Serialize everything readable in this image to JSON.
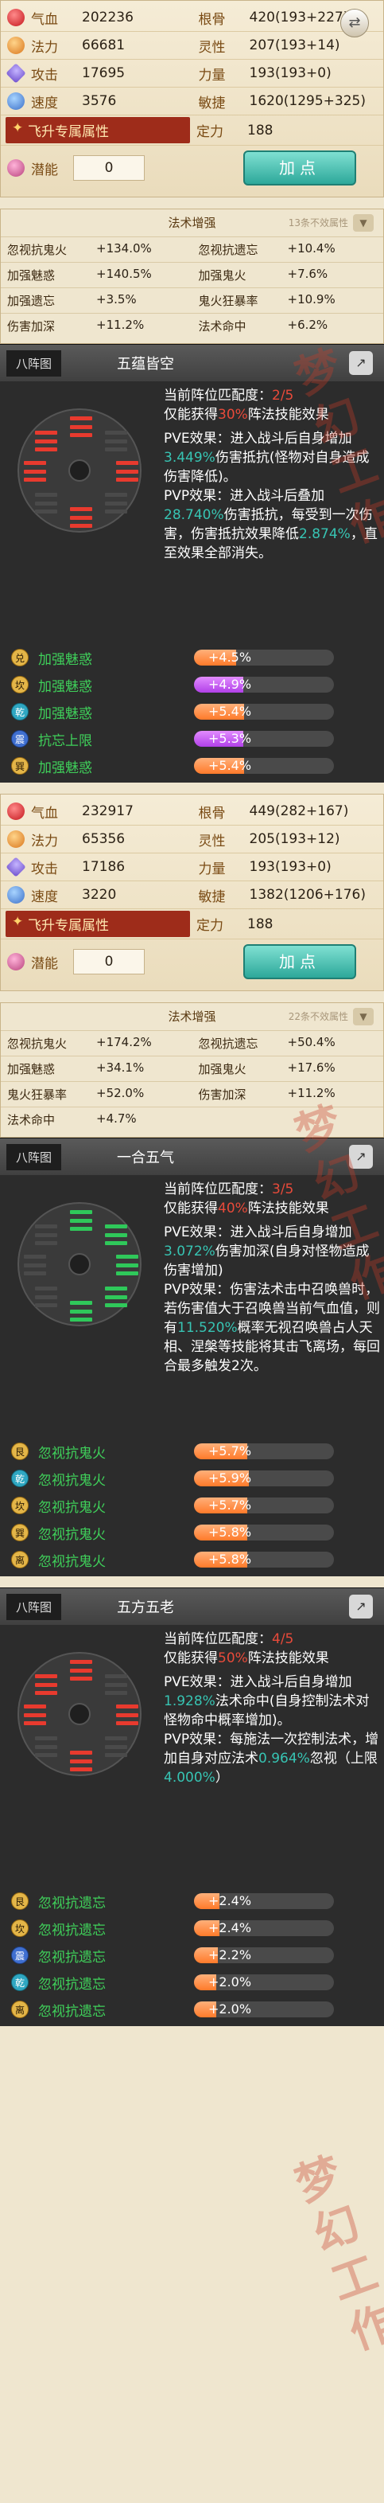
{
  "blocks": [
    {
      "stats": {
        "hp": {
          "label": "气血",
          "value": "202236"
        },
        "bone": {
          "label": "根骨",
          "value": "420(193+227)"
        },
        "mp": {
          "label": "法力",
          "value": "66681"
        },
        "spirit": {
          "label": "灵性",
          "value": "207(193+14)"
        },
        "atk": {
          "label": "攻击",
          "value": "17695"
        },
        "str": {
          "label": "力量",
          "value": "193(193+0)"
        },
        "spd": {
          "label": "速度",
          "value": "3576"
        },
        "agi": {
          "label": "敏捷",
          "value": "1620(1295+325)"
        },
        "ascend_label": "飞升专属属性",
        "focus": {
          "label": "定力",
          "value": "188"
        },
        "potential": {
          "label": "潜能",
          "value": "0"
        },
        "add_button": "加点"
      },
      "boost": {
        "title": "法术增强",
        "effective": "13条不效属性",
        "rows": [
          [
            {
              "k": "忽视抗鬼火",
              "v": "+134.0%"
            },
            {
              "k": "忽视抗遗忘",
              "v": "+10.4%"
            }
          ],
          [
            {
              "k": "加强魅惑",
              "v": "+140.5%"
            },
            {
              "k": "加强鬼火",
              "v": "+7.6%"
            }
          ],
          [
            {
              "k": "加强遗忘",
              "v": "+3.5%"
            },
            {
              "k": "鬼火狂暴率",
              "v": "+10.9%"
            }
          ],
          [
            {
              "k": "伤害加深",
              "v": "+11.2%"
            },
            {
              "k": "法术命中",
              "v": "+6.2%"
            }
          ]
        ]
      },
      "formations": [
        {
          "tag": "八阵图",
          "name": "五蕴皆空",
          "match_prefix": "当前阵位匹配度：",
          "match": "2/5",
          "gain_prefix": "仅能获得",
          "gain": "30%",
          "gain_suffix": "阵法技能效果",
          "pve": "PVE效果：进入战斗后自身增加",
          "pve_val": "3.449%",
          "pve_tail": "伤害抵抗(怪物对自身造成伤害降低)。",
          "pvp": "PVP效果：进入战斗后叠加",
          "pvp_val": "28.740%",
          "pvp_mid": "伤害抵抗，每受到一次伤害，伤害抵抗效果降低",
          "pvp_val2": "2.874%",
          "pvp_tail": "，直至效果全部消失。",
          "effects": [
            {
              "badge": "兑",
              "name": "加强魅惑",
              "value": "+4.5%",
              "fill": 0.3,
              "style": "orange"
            },
            {
              "badge": "坎",
              "name": "加强魅惑",
              "value": "+4.9%",
              "fill": 0.35,
              "style": "purple"
            },
            {
              "badge": "乾",
              "name": "加强魅惑",
              "value": "+5.4%",
              "fill": 0.36,
              "style": "orange"
            },
            {
              "badge": "震",
              "name": "抗忘上限",
              "value": "+5.3%",
              "fill": 0.35,
              "style": "purple"
            },
            {
              "badge": "巽",
              "name": "加强魅惑",
              "value": "+5.4%",
              "fill": 0.36,
              "style": "orange"
            }
          ]
        }
      ]
    },
    {
      "stats": {
        "hp": {
          "label": "气血",
          "value": "232917"
        },
        "bone": {
          "label": "根骨",
          "value": "449(282+167)"
        },
        "mp": {
          "label": "法力",
          "value": "65356"
        },
        "spirit": {
          "label": "灵性",
          "value": "205(193+12)"
        },
        "atk": {
          "label": "攻击",
          "value": "17186"
        },
        "str": {
          "label": "力量",
          "value": "193(193+0)"
        },
        "spd": {
          "label": "速度",
          "value": "3220"
        },
        "agi": {
          "label": "敏捷",
          "value": "1382(1206+176)"
        },
        "ascend_label": "飞升专属属性",
        "focus": {
          "label": "定力",
          "value": "188"
        },
        "potential": {
          "label": "潜能",
          "value": "0"
        },
        "add_button": "加点"
      },
      "boost": {
        "title": "法术增强",
        "effective": "22条不效属性",
        "rows": [
          [
            {
              "k": "忽视抗鬼火",
              "v": "+174.2%"
            },
            {
              "k": "忽视抗遗忘",
              "v": "+50.4%"
            }
          ],
          [
            {
              "k": "加强魅惑",
              "v": "+34.1%"
            },
            {
              "k": "加强鬼火",
              "v": "+17.6%"
            }
          ],
          [
            {
              "k": "鬼火狂暴率",
              "v": "+52.0%"
            },
            {
              "k": "伤害加深",
              "v": "+11.2%"
            }
          ],
          [
            {
              "k": "法术命中",
              "v": "+4.7%"
            },
            {
              "k": "",
              "v": ""
            }
          ]
        ]
      },
      "formations": [
        {
          "tag": "八阵图",
          "name": "一合五气",
          "match_prefix": "当前阵位匹配度：",
          "match": "3/5",
          "gain_prefix": "仅能获得",
          "gain": "40%",
          "gain_suffix": "阵法技能效果",
          "pve": "PVE效果：进入战斗后自身增加",
          "pve_val": "3.072%",
          "pve_tail": "伤害加深(自身对怪物造成伤害增加)",
          "pvp": "PVP效果：伤害法术击中召唤兽时，若伤害值大于召唤兽当前气血值，则有",
          "pvp_val": "11.520%",
          "pvp_mid": "概率无视召唤兽占人天相、涅槃等技能将其击飞离场，每回合最多触发2次。",
          "pvp_val2": "",
          "pvp_tail": "",
          "effects": [
            {
              "badge": "艮",
              "name": "忽视抗鬼火",
              "value": "+5.7%",
              "fill": 0.38,
              "style": "orange"
            },
            {
              "badge": "乾",
              "name": "忽视抗鬼火",
              "value": "+5.9%",
              "fill": 0.39,
              "style": "orange"
            },
            {
              "badge": "坎",
              "name": "忽视抗鬼火",
              "value": "+5.7%",
              "fill": 0.38,
              "style": "orange"
            },
            {
              "badge": "巽",
              "name": "忽视抗鬼火",
              "value": "+5.8%",
              "fill": 0.38,
              "style": "orange"
            },
            {
              "badge": "离",
              "name": "忽视抗鬼火",
              "value": "+5.8%",
              "fill": 0.38,
              "style": "orange"
            }
          ]
        },
        {
          "tag": "八阵图",
          "name": "五方五老",
          "match_prefix": "当前阵位匹配度：",
          "match": "4/5",
          "gain_prefix": "仅能获得",
          "gain": "50%",
          "gain_suffix": "阵法技能效果",
          "pve": "PVE效果：进入战斗后自身增加",
          "pve_val": "1.928%",
          "pve_tail": "法术命中(自身控制法术对怪物命中概率增加)。",
          "pvp": "PVP效果：每施法一次控制法术，增加自身对应法术",
          "pvp_val": "0.964%",
          "pvp_mid": "忽视（上限",
          "pvp_val2": "4.000%",
          "pvp_tail": "）",
          "effects": [
            {
              "badge": "艮",
              "name": "忽视抗遗忘",
              "value": "+2.4%",
              "fill": 0.18,
              "style": "orange"
            },
            {
              "badge": "坎",
              "name": "忽视抗遗忘",
              "value": "+2.4%",
              "fill": 0.18,
              "style": "orange"
            },
            {
              "badge": "震",
              "name": "忽视抗遗忘",
              "value": "+2.2%",
              "fill": 0.17,
              "style": "orange"
            },
            {
              "badge": "乾",
              "name": "忽视抗遗忘",
              "value": "+2.0%",
              "fill": 0.16,
              "style": "orange"
            },
            {
              "badge": "离",
              "name": "忽视抗遗忘",
              "value": "+2.0%",
              "fill": 0.16,
              "style": "orange"
            }
          ]
        }
      ]
    }
  ],
  "watermark": "梦幻工作"
}
